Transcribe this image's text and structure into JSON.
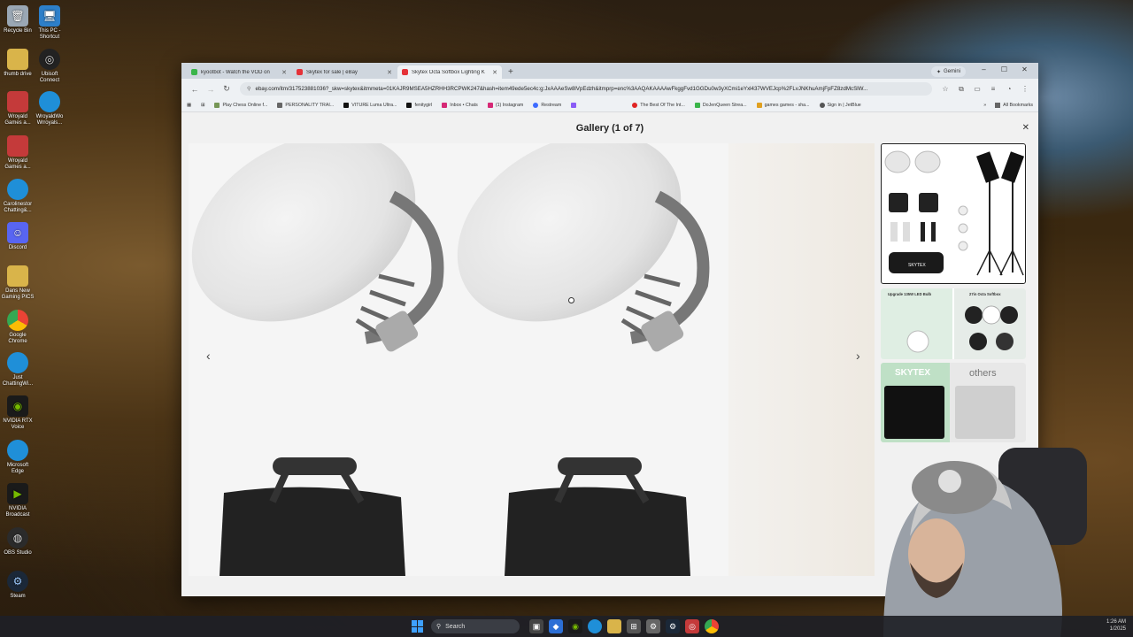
{
  "desktop": {
    "icons": [
      {
        "label": "Recycle Bin",
        "icon": "recycle-bin-icon"
      },
      {
        "label": "This PC - Shortcut",
        "icon": "pc-icon"
      },
      {
        "label": "thumb drive",
        "icon": "folder-icon"
      },
      {
        "label": "Ubisoft Connect",
        "icon": "ubisoft-icon"
      },
      {
        "label": "Wroyald Games a...",
        "icon": "folder-icon"
      },
      {
        "label": "WroyaldWo Wrroyals...",
        "icon": "edge-icon"
      },
      {
        "label": "Wroyald Games a...",
        "icon": "folder-icon"
      },
      {
        "label": "Carolinestor Chatting&...",
        "icon": "edge-icon"
      },
      {
        "label": "Discord",
        "icon": "discord-icon"
      },
      {
        "label": "Dans New Gaming PICS",
        "icon": "folder-icon"
      },
      {
        "label": "Google Chrome",
        "icon": "chrome-icon"
      },
      {
        "label": "Just ChattingWi...",
        "icon": "edge-icon"
      },
      {
        "label": "NVIDIA RTX Voice",
        "icon": "nvidia-icon"
      },
      {
        "label": "Microsoft Edge",
        "icon": "edge-icon"
      },
      {
        "label": "NVIDIA Broadcast",
        "icon": "nvidia-icon"
      },
      {
        "label": "OBS Studio",
        "icon": "obs-icon"
      },
      {
        "label": "Steam",
        "icon": "steam-icon"
      }
    ]
  },
  "browser": {
    "tabs": [
      {
        "label": "kyootbot - Watch the VOD on",
        "color": "#3ab54a"
      },
      {
        "label": "Skytex for sale | eBay",
        "color": "#e53238"
      },
      {
        "label": "Skytex Octa Softbox Lighting K",
        "color": "#e53238"
      }
    ],
    "gemini_label": "Gemini",
    "url": "ebay.com/itm/317523881036?_skw=skytex&itmmeta=01KAJR9MSEA5HZRHH3RCPWK247&hash=item49ede5ec4c:g:JxAAAeSw8lVpEdzh&itmprp=enc%3AAQAKAAAAwFkggFvd1GGDu0w3yXCmi1eYxl437WVEJcp%2FLvJNKhuAmjFpFZ8zdMcSlW...",
    "bookmarks": [
      {
        "label": "Play Chess Online f...",
        "color": "#769656"
      },
      {
        "label": "PERSONALITY TRAI...",
        "color": "#666666"
      },
      {
        "label": "VITURE Luma Ultra...",
        "color": "#111111"
      },
      {
        "label": "fenitygirl",
        "color": "#111111"
      },
      {
        "label": "Inbox • Chats",
        "color": "#d62976"
      },
      {
        "label": "(1) Instagram",
        "color": "#d62976"
      },
      {
        "label": "Restream",
        "color": "#3d6bff"
      },
      {
        "label": "",
        "color": "#8a5cf6"
      },
      {
        "label": "The Best Of The Int...",
        "color": "#e02424"
      },
      {
        "label": "DoJenQueen Strea...",
        "color": "#3ab54a"
      },
      {
        "label": "games games - sha...",
        "color": "#e0a020"
      },
      {
        "label": "Sign in | JetBlue",
        "color": "#555555"
      }
    ],
    "all_bookmarks": "All Bookmarks"
  },
  "gallery": {
    "title": "Gallery (1 of 7)",
    "thumbs": [
      {
        "label": "",
        "selected": true
      },
      {
        "label": "Upgrade 135W LED Bulb",
        "label2": "27in Octa Softbox",
        "selected": false
      },
      {
        "label": "SKYTEX",
        "label2": "others",
        "selected": false
      }
    ]
  },
  "taskbar": {
    "search_placeholder": "Search",
    "time": "1:26 AM",
    "date": "1/2025"
  }
}
